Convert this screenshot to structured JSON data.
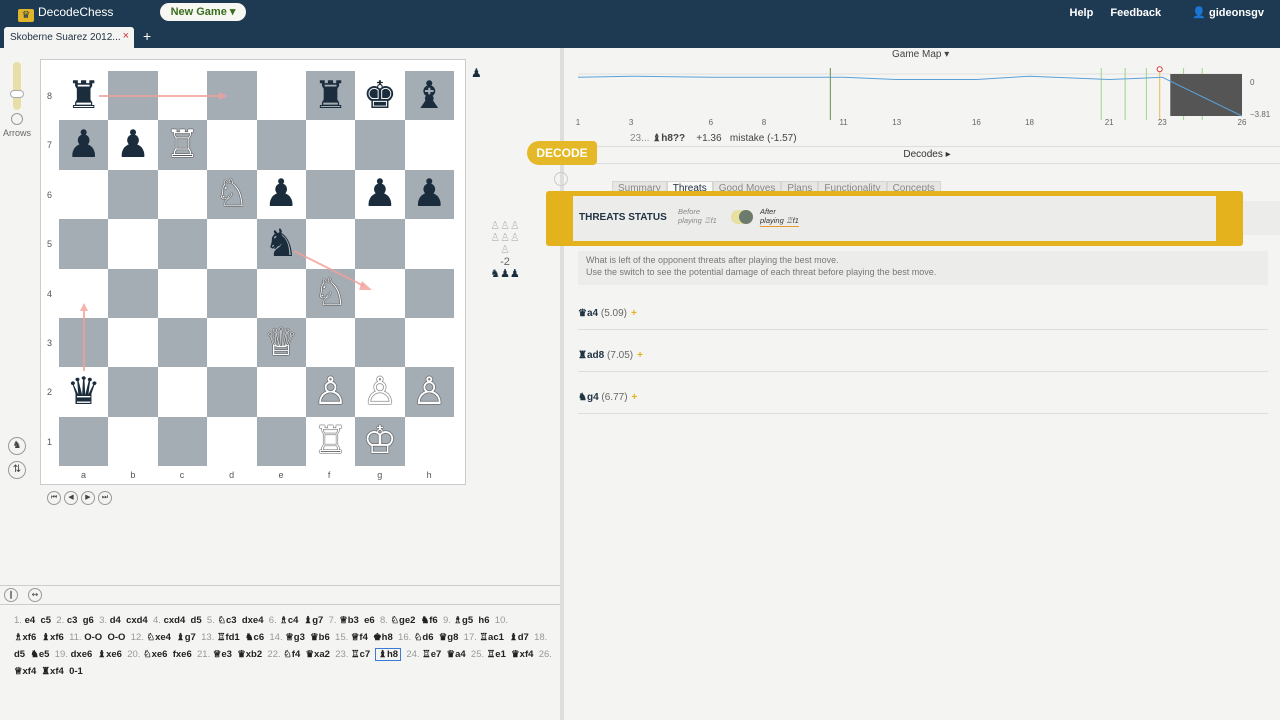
{
  "app": {
    "name": "DecodeChess",
    "new_game": "New Game ▾"
  },
  "nav": {
    "help": "Help",
    "feedback": "Feedback",
    "user": "gideonsgv"
  },
  "tabs": [
    {
      "label": "Skoberne Suarez 2012...",
      "close": "×"
    }
  ],
  "tab_add": "+",
  "board": {
    "arrows_label": "Arrows",
    "ranks": [
      "8",
      "7",
      "6",
      "5",
      "4",
      "3",
      "2",
      "1"
    ],
    "files": [
      "a",
      "b",
      "c",
      "d",
      "e",
      "f",
      "g",
      "h"
    ],
    "turn_marker": "♟",
    "pieces": {
      "a8": "♜b",
      "f8": "♜b",
      "g8": "♚b",
      "h8": "♝b",
      "a7": "♟b",
      "b7": "♟b",
      "c7": "♖w",
      "d6": "♘w",
      "e6": "♟b",
      "g6": "♟b",
      "h6": "♟b",
      "e5": "♞b",
      "f4": "♘w",
      "e3": "♕w",
      "a2": "♛b",
      "f2": "♙w",
      "g2": "♙w",
      "h2": "♙w",
      "f1": "♖w",
      "g1": "♔w"
    },
    "material": {
      "white_pawns": "♙♙♙",
      "white_more": "♙♙♙",
      "white_one": "♙",
      "diff": "-2",
      "black": "♞♟♟"
    }
  },
  "nav_buttons": [
    "⏮",
    "◀",
    "▶",
    "⏭"
  ],
  "moves": [
    {
      "n": "1.",
      "w": "e4",
      "b": "c5"
    },
    {
      "n": "2.",
      "w": "c3",
      "b": "g6"
    },
    {
      "n": "3.",
      "w": "d4",
      "b": "cxd4"
    },
    {
      "n": "4.",
      "w": "cxd4",
      "b": "d5"
    },
    {
      "n": "5.",
      "w": "♘c3",
      "b": "dxe4"
    },
    {
      "n": "6.",
      "w": "♗c4",
      "b": "♝g7"
    },
    {
      "n": "7.",
      "w": "♕b3",
      "b": "e6"
    },
    {
      "n": "8.",
      "w": "♘ge2",
      "b": "♞f6"
    },
    {
      "n": "9.",
      "w": "♗g5",
      "b": "h6"
    },
    {
      "n": "10.",
      "w": "♗xf6",
      "b": "♝xf6"
    },
    {
      "n": "11.",
      "w": "O-O",
      "b": "O-O"
    },
    {
      "n": "12.",
      "w": "♘xe4",
      "b": "♝g7"
    },
    {
      "n": "13.",
      "w": "♖fd1",
      "b": "♞c6"
    },
    {
      "n": "14.",
      "w": "♕g3",
      "b": "♛b6"
    },
    {
      "n": "15.",
      "w": "♕f4",
      "b": "♚h8"
    },
    {
      "n": "16.",
      "w": "♘d6",
      "b": "♛g8"
    },
    {
      "n": "17.",
      "w": "♖ac1",
      "b": ""
    },
    {
      "n": "",
      "w": "",
      "b": "♝d7"
    },
    {
      "n": "18.",
      "w": "d5",
      "b": "♞e5"
    },
    {
      "n": "19.",
      "w": "dxe6",
      "b": "♝xe6"
    },
    {
      "n": "20.",
      "w": "♘xe6",
      "b": "fxe6"
    },
    {
      "n": "21.",
      "w": "♕e3",
      "b": "♛xb2"
    },
    {
      "n": "22.",
      "w": "♘f4",
      "b": "♛xa2"
    },
    {
      "n": "23.",
      "w": "♖c7",
      "b": "♝h8"
    },
    {
      "n": "24.",
      "w": "♖e7",
      "b": "♛a4"
    },
    {
      "n": "25.",
      "w": "♖e1",
      "b": "♛xf4"
    },
    {
      "n": "26.",
      "w": "♕xf4",
      "b": "♜xf4"
    },
    {
      "n": "",
      "w": "0-1",
      "b": ""
    }
  ],
  "game_map": {
    "title": "Game Map ▾",
    "x_ticks": [
      "1",
      "3",
      "6",
      "8",
      "11",
      "13",
      "16",
      "18",
      "21",
      "23",
      "26"
    ],
    "y_top": "0",
    "y_bottom": "−3.81"
  },
  "chart_data": {
    "type": "line",
    "title": "Game Map",
    "x": [
      1,
      3,
      6,
      8,
      11,
      13,
      16,
      18,
      21,
      23,
      26
    ],
    "ylim": [
      -3.81,
      0
    ],
    "series": [
      {
        "values": [
          -0.3,
          -0.2,
          -0.3,
          -0.3,
          -0.3,
          -0.5,
          -0.5,
          -0.2,
          -0.5,
          -0.3,
          -3.81
        ]
      }
    ]
  },
  "move_info": {
    "num": "23...",
    "move": "♝h8??",
    "eval": "+1.36",
    "label": "mistake (-1.57)"
  },
  "decodes": {
    "label": "Decodes ▸",
    "badge": "DECODE"
  },
  "decode_tabs": [
    "Summary",
    "Threats",
    "Good Moves",
    "Plans",
    "Functionality",
    "Concepts"
  ],
  "threats_status": {
    "label": "THREATS STATUS",
    "before": [
      "Before",
      "playing ♖f1"
    ],
    "after": [
      "After",
      "playing ♖f1"
    ],
    "description": [
      "What is left of the opponent threats after playing the best move.",
      "Use the switch to see the potential damage of each threat before playing the best move."
    ]
  },
  "threats": [
    {
      "move": "♛a4",
      "score": "(5.09)",
      "plus": "+"
    },
    {
      "move": "♜ad8",
      "score": "(7.05)",
      "plus": "+"
    },
    {
      "move": "♞g4",
      "score": "(6.77)",
      "plus": "+"
    }
  ]
}
